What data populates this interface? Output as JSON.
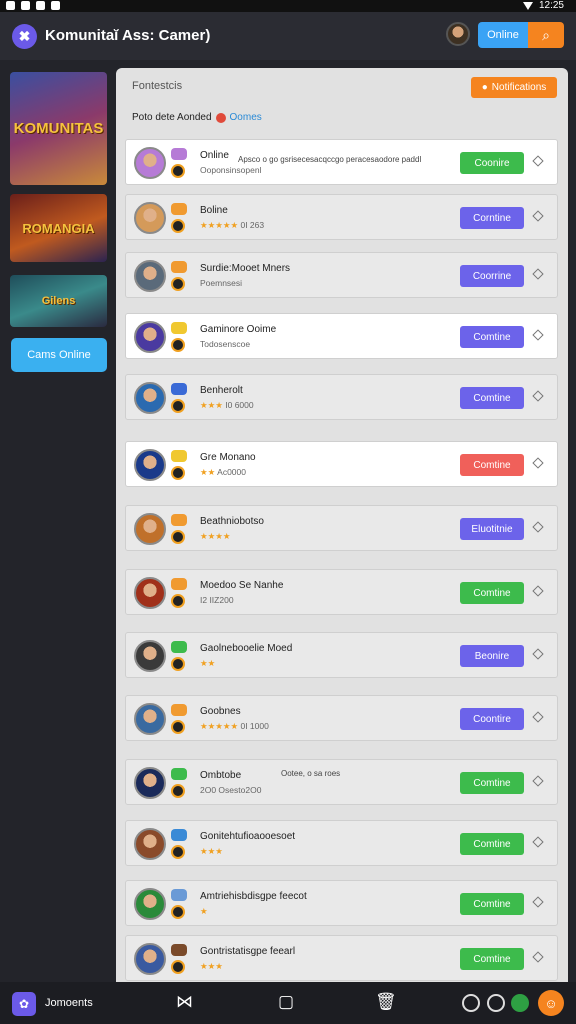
{
  "status": {
    "time": "12:25"
  },
  "header": {
    "title": "Komunitaĭ Ass: Camer)",
    "online_label": "Online",
    "search_icon": "search-icon"
  },
  "sidebar": {
    "promos": [
      "KOMUNITAS",
      "ROMANGIA",
      "Gilens"
    ],
    "button_label": "Cams Online"
  },
  "main": {
    "heading": "Fontestcis",
    "notify_label": "Notifications",
    "filter_label": "Poto dete Aonded",
    "filter_games": "Oomes"
  },
  "list": [
    {
      "name": "Online",
      "sub": "Ooponsinsopenl",
      "desc": "Apsco o go gsrisecesacqccgo peracesaodore paddl",
      "action": "Coonire",
      "style": "green",
      "white": true,
      "avatar": "#b67bd6"
    },
    {
      "name": "Boline",
      "stars": "★★★★★",
      "sub": "0I 263",
      "action": "Corntine",
      "style": "purple",
      "white": false,
      "avatar": "#d49a5a"
    },
    {
      "name": "Surdie:Mooet Mners",
      "sub": "Poemnsesi",
      "action": "Coorrine",
      "style": "purple",
      "white": false,
      "avatar": "#5a6a7a"
    },
    {
      "name": "Gaminore Ooime",
      "sub": "Todosenscoe",
      "action": "Comtine",
      "style": "purple",
      "white": true,
      "avatar": "#4a3aa0"
    },
    {
      "name": "Benherolt",
      "stars": "★★★",
      "sub": "I0 6000",
      "action": "Comtine",
      "style": "purple",
      "white": false,
      "avatar": "#2a6ab0"
    },
    {
      "name": "Gre Monano",
      "stars": "★★",
      "sub": "Ac0000",
      "action": "Comtine",
      "style": "red",
      "white": true,
      "avatar": "#1a3a8a"
    },
    {
      "name": "Beathniobotso",
      "stars": "★★★★",
      "sub": "",
      "action": "Eluotitnie",
      "style": "purple",
      "white": false,
      "avatar": "#c0702a"
    },
    {
      "name": "Moedoo Se Nanhe",
      "sub": "I2 IIZ200",
      "action": "Comtine",
      "style": "green",
      "white": false,
      "avatar": "#a0301a"
    },
    {
      "name": "Gaolnebooelie Moed",
      "stars": "★★",
      "sub": "",
      "action": "Beonire",
      "style": "purple",
      "white": false,
      "avatar": "#3a3a3a"
    },
    {
      "name": "Goobnes",
      "stars": "★★★★★",
      "sub": "0I 1000",
      "action": "Coontire",
      "style": "purple",
      "white": false,
      "avatar": "#3a6aa0"
    },
    {
      "name": "Ombtobe",
      "sub": "2O0 Osesto2O0",
      "desc": "Ootee, o sa roes",
      "action": "Comtine",
      "style": "green",
      "white": false,
      "avatar": "#1a2a5a"
    },
    {
      "name": "Gonitehtufioaooesoet",
      "stars": "★★★",
      "sub": "",
      "action": "Comtine",
      "style": "green",
      "white": false,
      "avatar": "#8a4a2a"
    },
    {
      "name": "Amtriehisbdisgpe feecot",
      "stars": "★",
      "sub": "",
      "action": "Comtine",
      "style": "green",
      "white": false,
      "avatar": "#2a8a3a"
    },
    {
      "name": "Gontristatisgpe feearl",
      "stars": "★★★",
      "sub": "",
      "action": "Comtine",
      "style": "green",
      "white": false,
      "avatar": "#3a5aa0"
    }
  ],
  "bottom": {
    "label": "Jomoents"
  }
}
